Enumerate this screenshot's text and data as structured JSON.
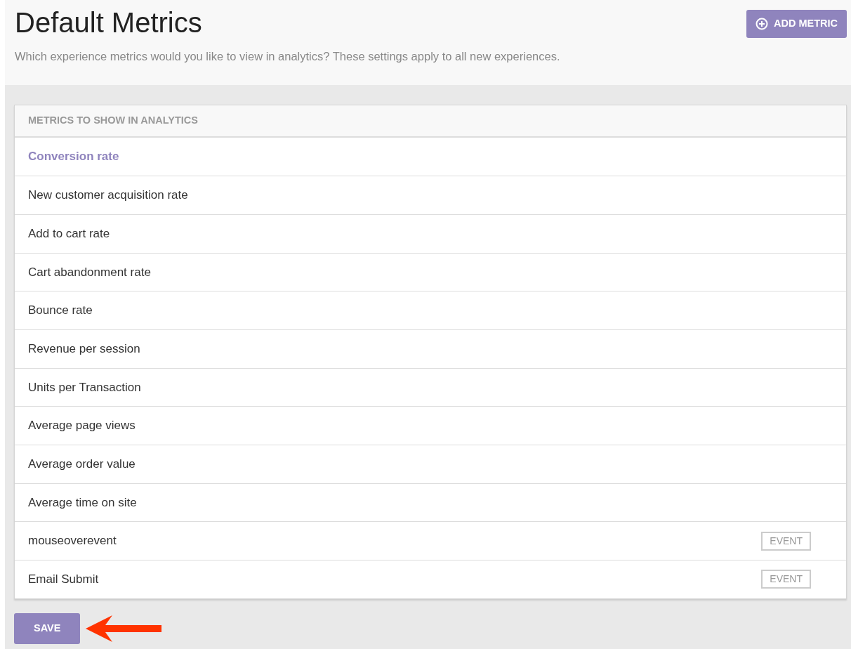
{
  "header": {
    "title": "Default Metrics",
    "subtitle": "Which experience metrics would you like to view in analytics? These settings apply to all new experiences.",
    "add_button": "ADD METRIC"
  },
  "metrics_panel": {
    "heading": "METRICS TO SHOW IN ANALYTICS",
    "rows": [
      {
        "label": "Conversion rate",
        "selected": true
      },
      {
        "label": "New customer acquisition rate",
        "selected": false
      },
      {
        "label": "Add to cart rate",
        "selected": false
      },
      {
        "label": "Cart abandonment rate",
        "selected": false
      },
      {
        "label": "Bounce rate",
        "selected": false
      },
      {
        "label": "Revenue per session",
        "selected": false
      },
      {
        "label": "Units per Transaction",
        "selected": false
      },
      {
        "label": "Average page views",
        "selected": false
      },
      {
        "label": "Average order value",
        "selected": false
      },
      {
        "label": "Average time on site",
        "selected": false
      },
      {
        "label": "mouseoverevent",
        "selected": false,
        "tag": "EVENT"
      },
      {
        "label": "Email Submit",
        "selected": false,
        "tag": "EVENT"
      }
    ]
  },
  "save_button": "SAVE"
}
